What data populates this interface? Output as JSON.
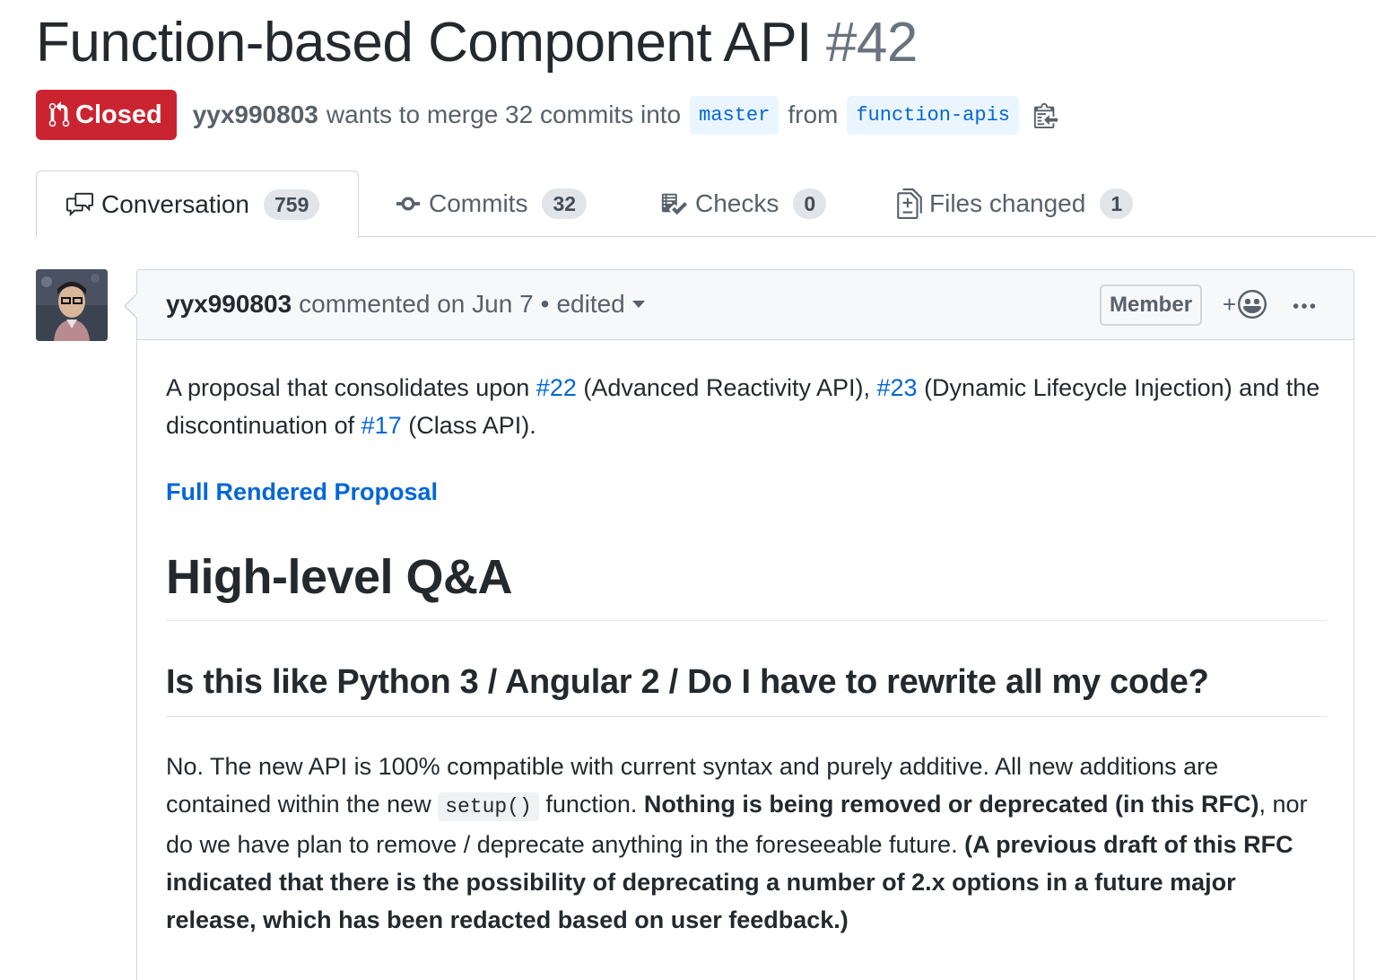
{
  "pr": {
    "title": "Function-based Component API",
    "number": "#42",
    "state": "Closed",
    "author": "yyx990803",
    "merge_text": "wants to merge 32 commits into",
    "base_branch": "master",
    "from_text": "from",
    "head_branch": "function-apis"
  },
  "tabs": [
    {
      "label": "Conversation",
      "count": "759",
      "icon": "comment-discussion-icon"
    },
    {
      "label": "Commits",
      "count": "32",
      "icon": "git-commit-icon"
    },
    {
      "label": "Checks",
      "count": "0",
      "icon": "checklist-icon"
    },
    {
      "label": "Files changed",
      "count": "1",
      "icon": "diff-icon"
    }
  ],
  "comment": {
    "author": "yyx990803",
    "action": "commented on Jun 7",
    "separator": "•",
    "edited": "edited",
    "role": "Member",
    "reaction_plus": "+",
    "body": {
      "intro_1": "A proposal that consolidates upon ",
      "link_22": "#22",
      "intro_2": " (Advanced Reactivity API), ",
      "link_23": "#23",
      "intro_3": " (Dynamic Lifecycle Injection) and the discontinuation of ",
      "link_17": "#17",
      "intro_4": " (Class API).",
      "full_link": "Full Rendered Proposal",
      "h1": "High-level Q&A",
      "h2": "Is this like Python 3 / Angular 2 / Do I have to rewrite all my code?",
      "p2_1": "No. The new API is 100% compatible with current syntax and purely additive. All new additions are contained within the new ",
      "p2_code": "setup()",
      "p2_2": " function. ",
      "p2_bold1": "Nothing is being removed or deprecated (in this RFC)",
      "p2_3": ", nor do we have plan to remove / deprecate anything in the foreseeable future. ",
      "p2_bold2": "(A previous draft of this RFC indicated that there is the possibility of deprecating a number of 2.x options in a future major release, which has been redacted based on user feedback.)"
    }
  },
  "colors": {
    "closed_red": "#cb2431",
    "link_blue": "#0366d6",
    "branch_bg": "#eaf5ff",
    "header_bg": "#f6f8fa"
  }
}
